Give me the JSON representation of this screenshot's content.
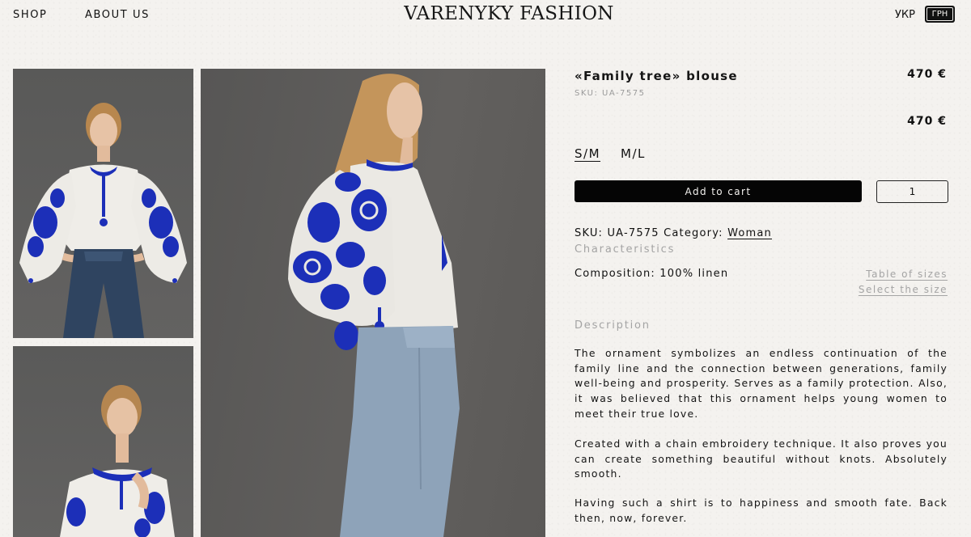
{
  "nav": {
    "shop": "SHOP",
    "about": "ABOUT US"
  },
  "brand": {
    "logo": "VARENYKY FASHION"
  },
  "header_right": {
    "language": "УКР",
    "currency": "ГРН"
  },
  "product": {
    "title": "«Family tree» blouse",
    "sku_small": "SKU: UA-7575",
    "price_top": "470 €",
    "price_second": "470 €",
    "sizes": [
      "S/M",
      "M/L"
    ],
    "selected_size": "S/M",
    "add_to_cart": "Add to cart",
    "quantity": "1",
    "meta": {
      "sku_label": "SKU: UA-7575",
      "category_label": "Category:",
      "category_value": "Woman"
    },
    "characteristics_heading": "Characteristics",
    "composition": "Composition: 100% linen",
    "table_of_sizes": "Table of sizes",
    "select_size": "Select the size",
    "description_heading": "Description",
    "description": [
      "The ornament symbolizes an endless continuation of the family line and the connection between generations, family well-being and prosperity. Serves as a family protection. Also, it was believed that this ornament helps young women to meet their true love.",
      "Created with a chain embroidery technique. It also proves you can create something beautiful without knots. Absolutely smooth.",
      "Having such a shirt is to happiness and smooth fate. Back then, now, forever."
    ]
  },
  "colors": {
    "background": "#f4f2ef",
    "text": "#111111",
    "muted": "#a4a4a4",
    "embroidery": "#1c2fb8",
    "button": "#050505"
  }
}
